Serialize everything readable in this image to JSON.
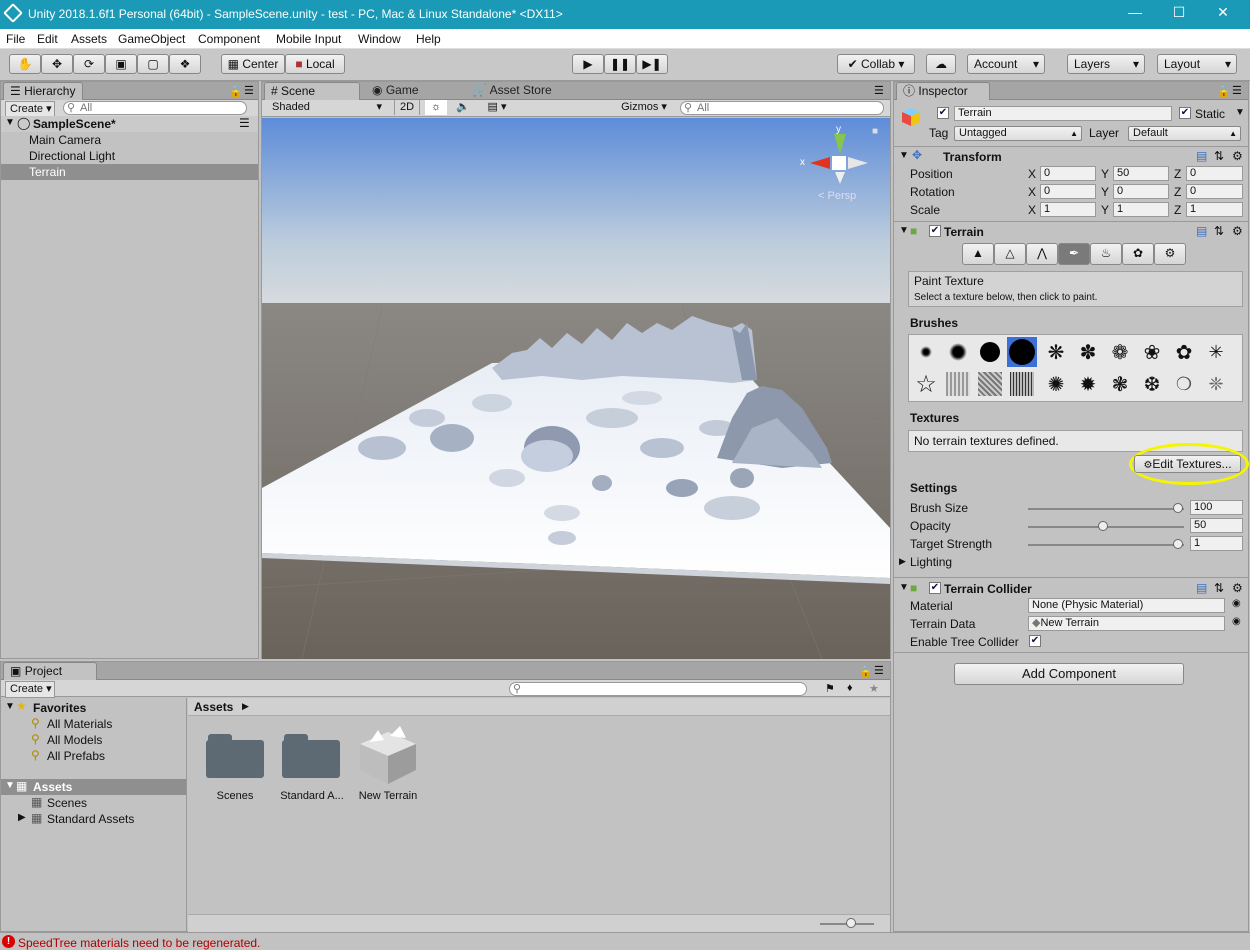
{
  "window": {
    "title": "Unity 2018.1.6f1 Personal (64bit) - SampleScene.unity - test - PC, Mac & Linux Standalone* <DX11>"
  },
  "menu": [
    "File",
    "Edit",
    "Assets",
    "GameObject",
    "Component",
    "Mobile Input",
    "Window",
    "Help"
  ],
  "toolbar": {
    "center": "Center",
    "local": "Local",
    "collab": "Collab",
    "account": "Account",
    "layers": "Layers",
    "layout": "Layout"
  },
  "hierarchy": {
    "tab": "Hierarchy",
    "create": "Create",
    "search_placeholder": "All",
    "scene": "SampleScene*",
    "items": [
      "Main Camera",
      "Directional Light",
      "Terrain"
    ]
  },
  "scene": {
    "tab_scene": "Scene",
    "tab_game": "Game",
    "tab_store": "Asset Store",
    "shading": "Shaded",
    "mode2d": "2D",
    "gizmos": "Gizmos",
    "search_placeholder": "All",
    "persp": "Persp",
    "axis_x": "x",
    "axis_y": "y"
  },
  "project": {
    "tab": "Project",
    "create": "Create",
    "favorites": "Favorites",
    "fav_items": [
      "All Materials",
      "All Models",
      "All Prefabs"
    ],
    "assets_root": "Assets",
    "asset_children": [
      "Scenes",
      "Standard Assets"
    ],
    "breadcrumb": "Assets",
    "files": [
      "Scenes",
      "Standard A...",
      "New Terrain"
    ]
  },
  "inspector": {
    "tab": "Inspector",
    "name": "Terrain",
    "static": "Static",
    "tag_label": "Tag",
    "tag_value": "Untagged",
    "layer_label": "Layer",
    "layer_value": "Default",
    "transform": {
      "title": "Transform",
      "rows": [
        {
          "label": "Position",
          "x": "0",
          "y": "50",
          "z": "0"
        },
        {
          "label": "Rotation",
          "x": "0",
          "y": "0",
          "z": "0"
        },
        {
          "label": "Scale",
          "x": "1",
          "y": "1",
          "z": "1"
        }
      ],
      "axis_x": "X",
      "axis_y": "Y",
      "axis_z": "Z"
    },
    "terrain": {
      "title": "Terrain",
      "paint_title": "Paint Texture",
      "paint_hint": "Select a texture below, then click to paint.",
      "brushes_label": "Brushes",
      "textures_label": "Textures",
      "no_textures": "No terrain textures defined.",
      "edit_textures": "Edit Textures...",
      "settings_label": "Settings",
      "settings": [
        {
          "label": "Brush Size",
          "value": "100",
          "level": 1.0
        },
        {
          "label": "Opacity",
          "value": "50",
          "level": 0.5
        },
        {
          "label": "Target Strength",
          "value": "1",
          "level": 1.0
        }
      ],
      "lighting": "Lighting"
    },
    "collider": {
      "title": "Terrain Collider",
      "material_label": "Material",
      "material_value": "None (Physic Material)",
      "data_label": "Terrain Data",
      "data_value": "New Terrain",
      "tree_label": "Enable Tree Collider"
    },
    "add_component": "Add Component"
  },
  "status": {
    "message": "SpeedTree materials need to be regenerated.",
    "color": "#cc0000"
  },
  "colors": {
    "accent": "#1a9ab6",
    "highlight": "#f5f500",
    "selection": "#8f8f8f"
  }
}
